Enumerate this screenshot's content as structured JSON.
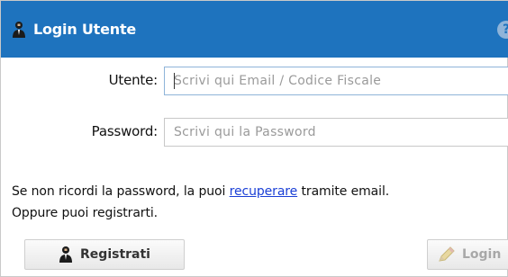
{
  "dialog": {
    "title": "Login Utente",
    "help_glyph": "?",
    "title_icon": "user-icon",
    "header_color": "#1e73be"
  },
  "form": {
    "utente_label": "Utente:",
    "utente_value": "",
    "utente_placeholder": "Scrivi qui Email / Codice Fiscale",
    "password_label": "Password:",
    "password_value": "",
    "password_placeholder": "Scrivi qui la Password"
  },
  "info": {
    "text_before_link": "Se non ricordi la password, la puoi ",
    "link_text": "recuperare",
    "text_after_link": " tramite email.",
    "second_line": "Oppure puoi registrarti.",
    "link_color": "#1a3fd6"
  },
  "buttons": {
    "register_label": "Registrati",
    "register_icon": "user-icon",
    "login_label": "Login",
    "login_icon": "pencil-icon"
  }
}
